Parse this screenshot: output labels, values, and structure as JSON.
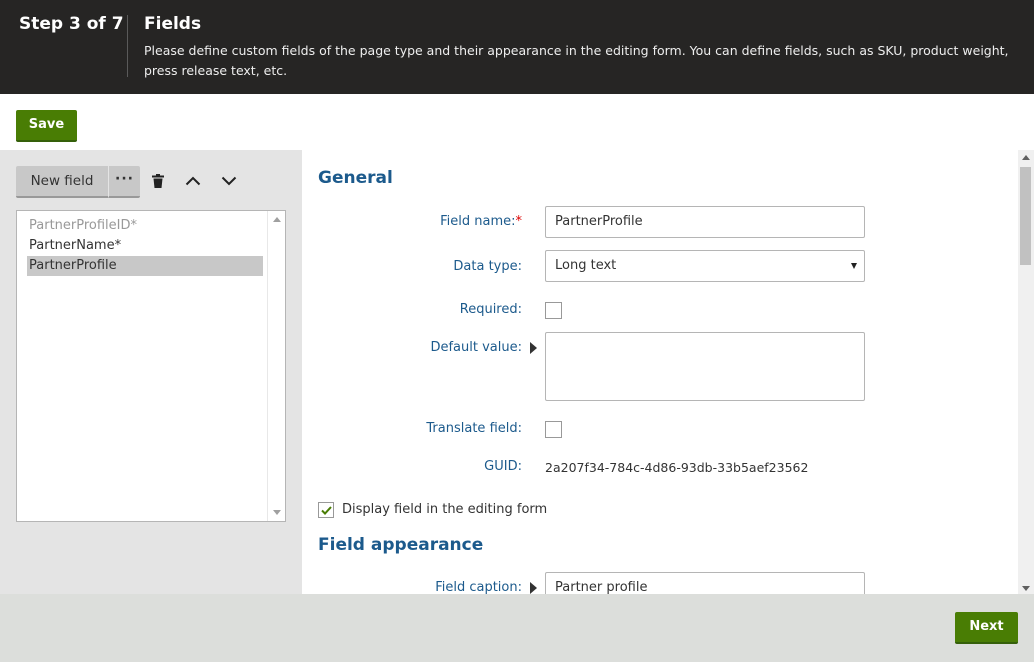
{
  "header": {
    "step": "Step 3 of 7",
    "title": "Fields",
    "description": "Please define custom fields of the page type and their appearance in the editing form. You can define fields, such as SKU, product weight, press release text, etc."
  },
  "toolbar": {
    "save_label": "Save",
    "new_field_label": "New field",
    "more_label": "···"
  },
  "field_list": {
    "items": [
      {
        "label": "PartnerProfileID*",
        "state": "disabled"
      },
      {
        "label": "PartnerName*",
        "state": "normal"
      },
      {
        "label": "PartnerProfile",
        "state": "selected"
      }
    ]
  },
  "general": {
    "title": "General",
    "field_name_label": "Field name:",
    "field_name_required": "*",
    "field_name_value": "PartnerProfile",
    "data_type_label": "Data type:",
    "data_type_value": "Long text",
    "required_label": "Required:",
    "required_checked": false,
    "default_value_label": "Default value:",
    "default_value": "",
    "translate_label": "Translate field:",
    "translate_checked": false,
    "guid_label": "GUID:",
    "guid_value": "2a207f34-784c-4d86-93db-33b5aef23562"
  },
  "display_in_form": {
    "label": "Display field in the editing form",
    "checked": true
  },
  "appearance": {
    "title": "Field appearance",
    "caption_label": "Field caption:",
    "caption_value": "Partner profile"
  },
  "footer": {
    "next_label": "Next"
  },
  "colors": {
    "header_bg": "#262524",
    "accent_green": "#497d04",
    "label_blue": "#1c5a8c"
  }
}
